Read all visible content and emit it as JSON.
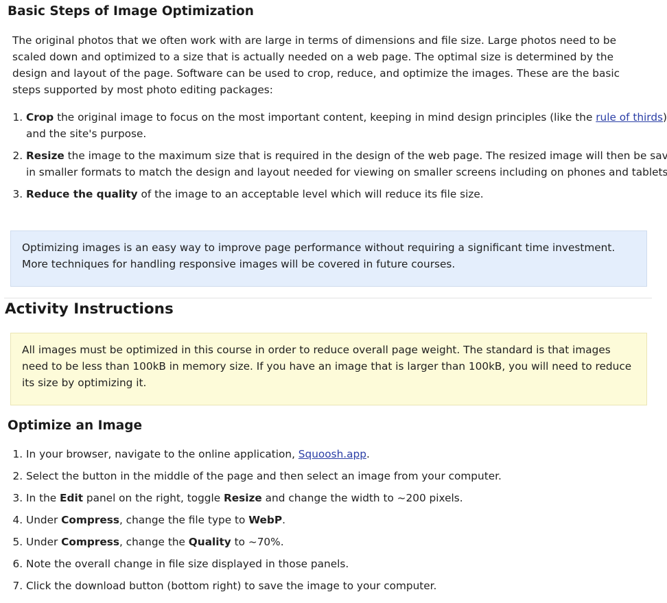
{
  "section1": {
    "title": "Basic Steps of Image Optimization",
    "intro": "The original photos that we often work with are large in terms of dimensions and file size. Large photos need to be scaled down and optimized to a size that is actually needed on a web page. The optimal size is determined by the design and layout of the page. Software can be used to crop, reduce, and optimize the images. These are the basic steps supported by most photo editing packages:",
    "steps": [
      {
        "bold": "Crop",
        "text_before_link": " the original image to focus on the most important content, keeping in mind design principles (like the ",
        "link": "rule of thirds",
        "text_after_link": ") and the site's purpose."
      },
      {
        "bold": "Resize",
        "text": " the image to the maximum size that is required in the design of the web page. The resized image will then be saved in smaller formats to match the design and layout needed for viewing on smaller screens including on phones and tablets."
      },
      {
        "bold": "Reduce the quality",
        "text": " of the image to an acceptable level which will reduce its file size."
      }
    ],
    "tip": "Optimizing images is an easy way to improve page performance without requiring a significant time investment. More techniques for handling responsive images will be covered in future courses."
  },
  "section2": {
    "title": "Activity Instructions",
    "note": "All images must be optimized in this course in order to reduce overall page weight. The standard is that images need to be less than 100kB in memory size. If you have an image that is larger than 100kB, you will need to reduce its size by optimizing it."
  },
  "section3": {
    "title": "Optimize an Image",
    "s1_before": "In your browser, navigate to the online application, ",
    "s1_link": "Squoosh.app",
    "s1_after": ".",
    "s2": "Select the button in the middle of the page and then select an image from your computer.",
    "s3_a": "In the ",
    "s3_b": "Edit",
    "s3_c": " panel on the right, toggle ",
    "s3_d": "Resize",
    "s3_e": " and change the width to ~200 pixels.",
    "s4_a": "Under ",
    "s4_b": "Compress",
    "s4_c": ", change the file type to ",
    "s4_d": "WebP",
    "s4_e": ".",
    "s5_a": "Under ",
    "s5_b": "Compress",
    "s5_c": ", change the ",
    "s5_d": "Quality",
    "s5_e": " to ~70%.",
    "s6": "Note the overall change in file size displayed in those panels.",
    "s7": "Click the download button (bottom right) to save the image to your computer."
  },
  "colors": {
    "link": "#2a3ea6",
    "tip_bg": "#e4eefc",
    "note_bg": "#fdfbd9"
  }
}
